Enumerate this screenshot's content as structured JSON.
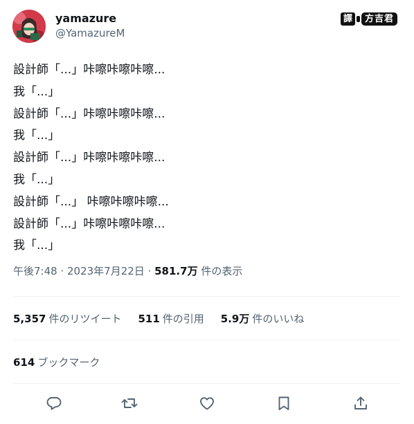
{
  "author": {
    "display_name": "yamazure",
    "handle": "@YamazureM"
  },
  "watermark": {
    "box": "譯",
    "name": "方吉君"
  },
  "tweet_lines": [
    "設計師「...」咔嚓咔嚓咔嚓...",
    "我「...」",
    "設計師「...」咔嚓咔嚓咔嚓...",
    "我「...」",
    "設計師「...」咔嚓咔嚓咔嚓...",
    "我「...」",
    "設計師「...」 咔嚓咔嚓咔嚓...",
    "設計師「...」咔嚓咔嚓咔嚓...",
    "我「...」"
  ],
  "meta": {
    "time": "午後7:48",
    "separator": " · ",
    "date": "2023年7月22日",
    "views_number": "581.7万",
    "views_label": " 件の表示"
  },
  "stats": {
    "retweets_number": "5,357",
    "retweets_label": "件のリツイート",
    "quotes_number": "511",
    "quotes_label": "件の引用",
    "likes_number": "5.9万",
    "likes_label": "件のいいね"
  },
  "bookmarks": {
    "number": "614",
    "label": "ブックマーク"
  },
  "actions": [
    "reply-icon",
    "retweet-icon",
    "like-icon",
    "bookmark-icon",
    "share-icon"
  ],
  "colors": {
    "text_primary": "#0f1419",
    "text_secondary": "#536471",
    "divider": "#eff3f4"
  }
}
